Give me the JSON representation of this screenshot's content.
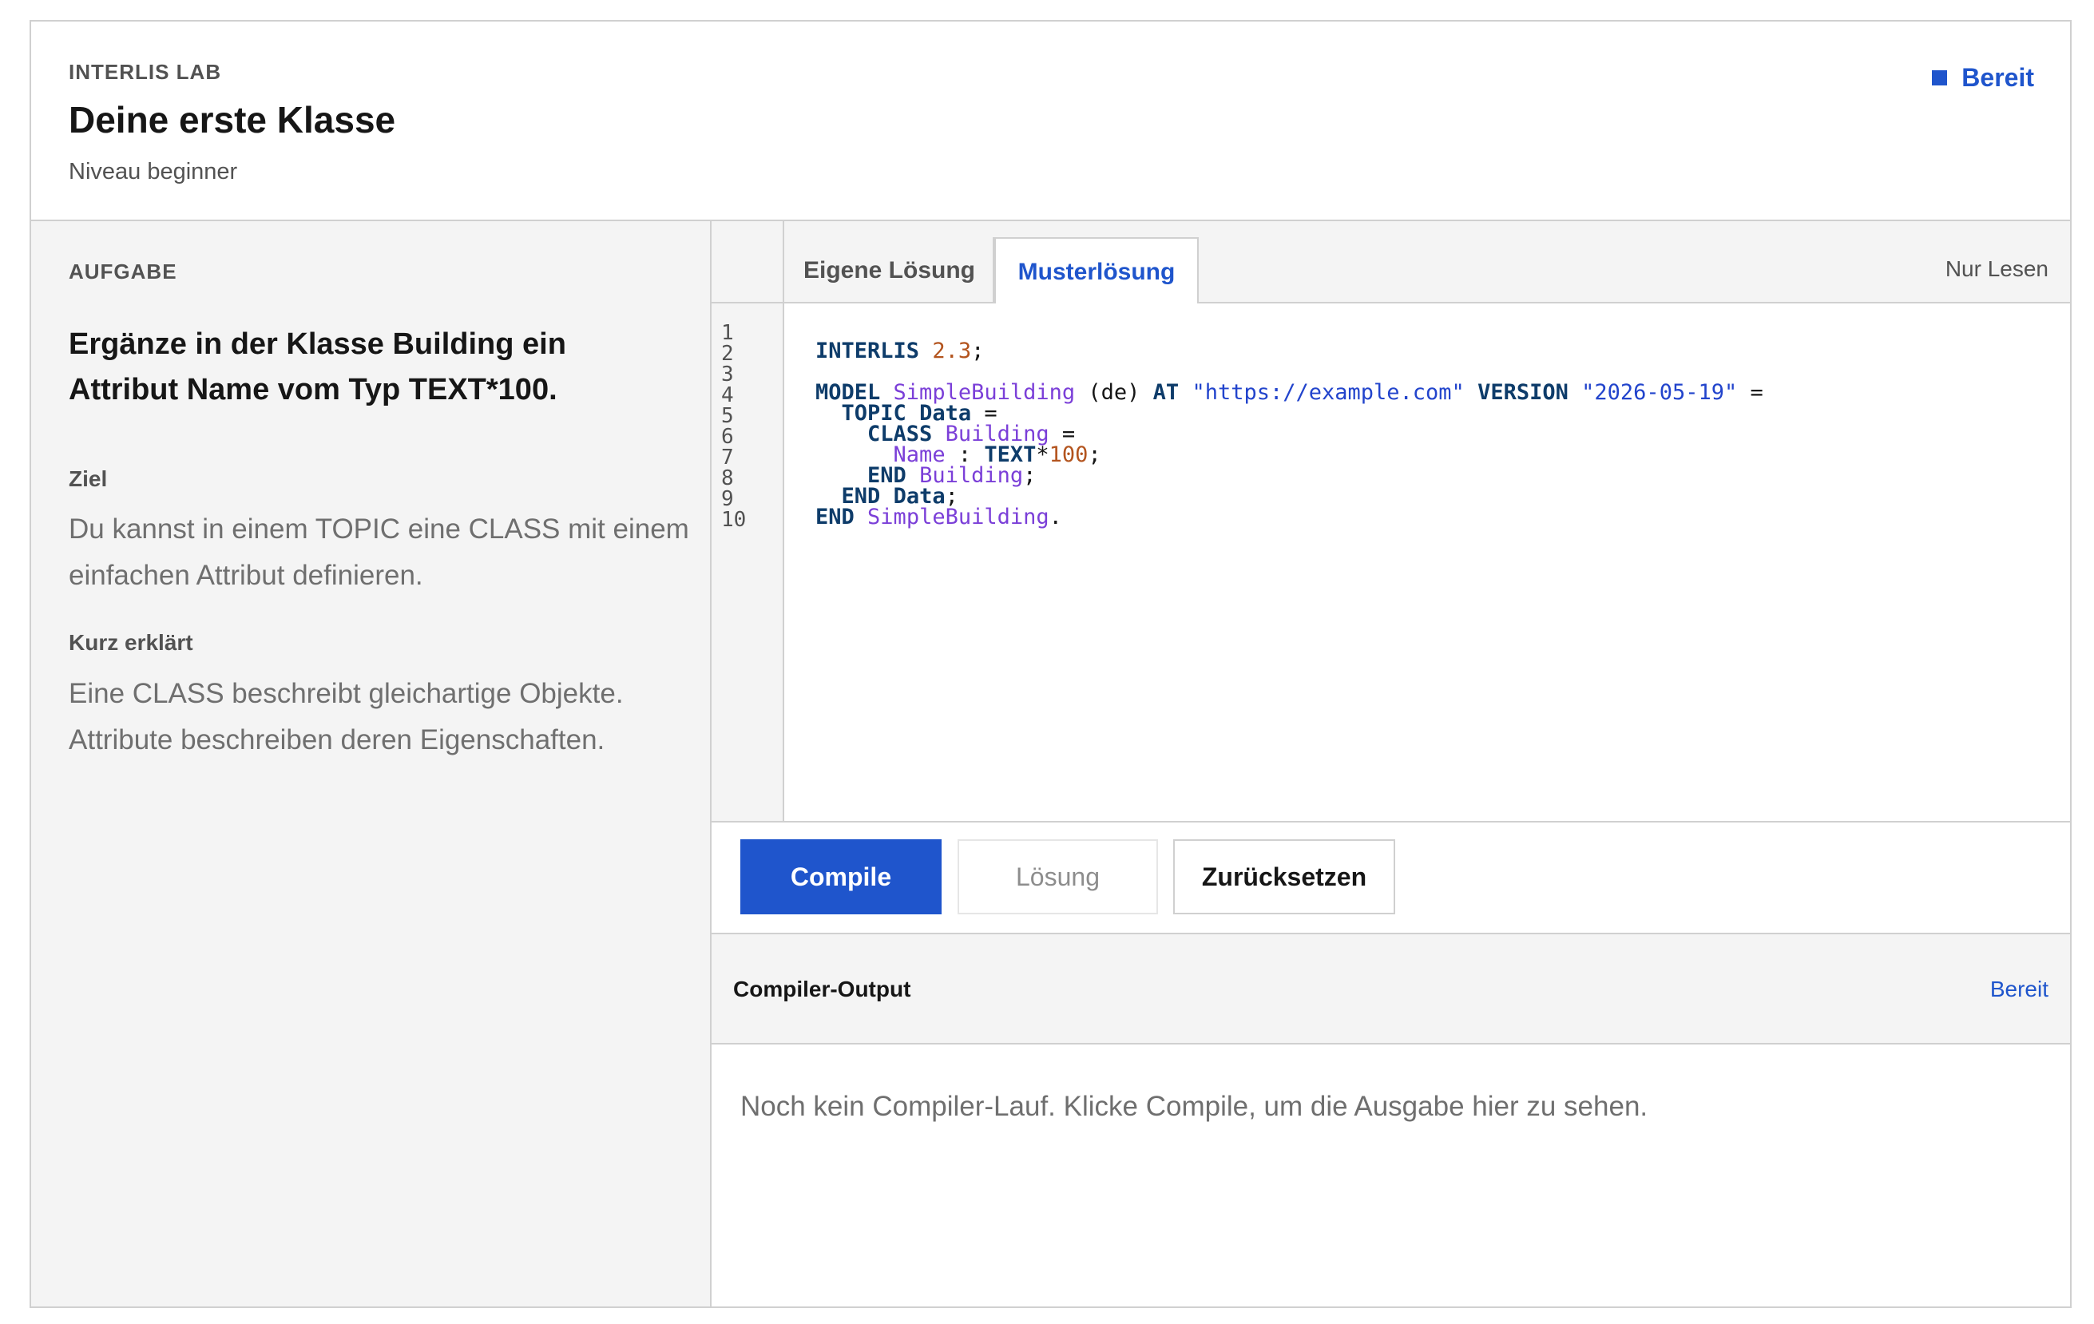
{
  "header": {
    "eyebrow": "INTERLIS LAB",
    "title": "Deine erste Klasse",
    "subtitle": "Niveau beginner",
    "status": "Bereit"
  },
  "task": {
    "eyebrow": "AUFGABE",
    "heading": "Ergänze in der Klasse Building ein Attribut Name vom Typ TEXT*100.",
    "goal_label": "Ziel",
    "goal_text": "Du kannst in einem TOPIC eine CLASS mit einem einfachen Attribut definieren.",
    "explain_label": "Kurz erklärt",
    "explain_text": "Eine CLASS beschreibt gleichartige Objekte. Attribute beschreiben deren Eigenschaften."
  },
  "tabs": {
    "own": "Eigene Lösung",
    "sample": "Musterlösung",
    "active": "sample",
    "readonly": "Nur Lesen"
  },
  "editor": {
    "line_numbers": [
      "1",
      "2",
      "3",
      "4",
      "5",
      "6",
      "7",
      "8",
      "9",
      "10"
    ],
    "lines": [
      [
        {
          "t": "INTERLIS",
          "c": "kw"
        },
        {
          "t": " ",
          "c": "plain"
        },
        {
          "t": "2.3",
          "c": "num"
        },
        {
          "t": ";",
          "c": "plain"
        }
      ],
      [],
      [
        {
          "t": "MODEL",
          "c": "kw"
        },
        {
          "t": " ",
          "c": "plain"
        },
        {
          "t": "SimpleBuilding",
          "c": "id"
        },
        {
          "t": " (de) ",
          "c": "plain"
        },
        {
          "t": "AT",
          "c": "kw"
        },
        {
          "t": " ",
          "c": "plain"
        },
        {
          "t": "\"https://example.com\"",
          "c": "str"
        },
        {
          "t": " ",
          "c": "plain"
        },
        {
          "t": "VERSION",
          "c": "kw"
        },
        {
          "t": " ",
          "c": "plain"
        },
        {
          "t": "\"2026-05-19\"",
          "c": "str"
        },
        {
          "t": " =",
          "c": "plain"
        }
      ],
      [
        {
          "t": "  ",
          "c": "plain"
        },
        {
          "t": "TOPIC",
          "c": "kw"
        },
        {
          "t": " ",
          "c": "plain"
        },
        {
          "t": "Data",
          "c": "kw"
        },
        {
          "t": " =",
          "c": "plain"
        }
      ],
      [
        {
          "t": "    ",
          "c": "plain"
        },
        {
          "t": "CLASS",
          "c": "kw"
        },
        {
          "t": " ",
          "c": "plain"
        },
        {
          "t": "Building",
          "c": "id"
        },
        {
          "t": " =",
          "c": "plain"
        }
      ],
      [
        {
          "t": "      ",
          "c": "plain"
        },
        {
          "t": "Name",
          "c": "id"
        },
        {
          "t": " : ",
          "c": "plain"
        },
        {
          "t": "TEXT",
          "c": "kw"
        },
        {
          "t": "*",
          "c": "plain"
        },
        {
          "t": "100",
          "c": "num"
        },
        {
          "t": ";",
          "c": "plain"
        }
      ],
      [
        {
          "t": "    ",
          "c": "plain"
        },
        {
          "t": "END",
          "c": "kw"
        },
        {
          "t": " ",
          "c": "plain"
        },
        {
          "t": "Building",
          "c": "id"
        },
        {
          "t": ";",
          "c": "plain"
        }
      ],
      [
        {
          "t": "  ",
          "c": "plain"
        },
        {
          "t": "END",
          "c": "kw"
        },
        {
          "t": " ",
          "c": "plain"
        },
        {
          "t": "Data",
          "c": "kw"
        },
        {
          "t": ";",
          "c": "plain"
        }
      ],
      [
        {
          "t": "END",
          "c": "kw"
        },
        {
          "t": " ",
          "c": "plain"
        },
        {
          "t": "SimpleBuilding",
          "c": "id"
        },
        {
          "t": ".",
          "c": "plain"
        }
      ],
      []
    ]
  },
  "buttons": {
    "compile": "Compile",
    "solution": "Lösung",
    "reset": "Zurücksetzen"
  },
  "output": {
    "title": "Compiler-Output",
    "status": "Bereit",
    "text": "Noch kein Compiler-Lauf. Klicke Compile, um die Ausgabe hier zu sehen."
  },
  "colors": {
    "accent": "#1f55cc",
    "keyword": "#0e3c6a",
    "identifier": "#7b3fd8",
    "number": "#b3541e",
    "string": "#2244cc"
  }
}
